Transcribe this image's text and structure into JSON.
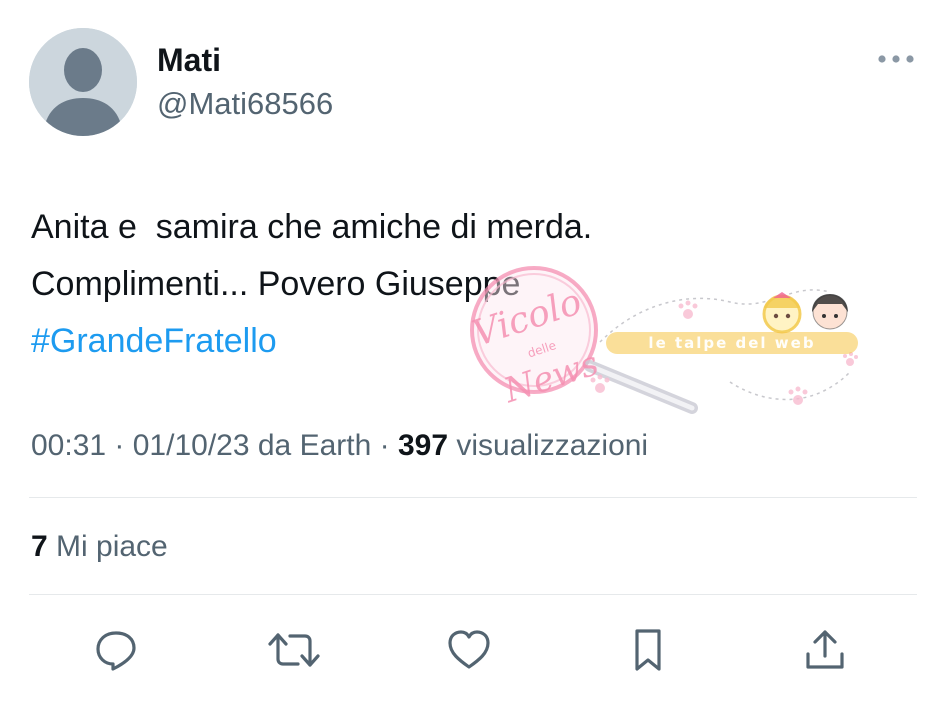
{
  "tweet": {
    "author": {
      "display_name": "Mati",
      "handle": "@Mati68566",
      "avatar": "default-avatar-placeholder"
    },
    "more_icon": "more-horizontal-icon",
    "text_lines": [
      "Anita e  samira che amiche di merda.",
      "Complimenti... Povero Giuseppe"
    ],
    "hashtag": "#GrandeFratello",
    "meta": {
      "time": "00:31",
      "separator1": " · ",
      "date": "01/10/23",
      "source": " da Earth",
      "separator2": " · ",
      "views_count": "397",
      "views_label": " visualizzazioni"
    },
    "likes": {
      "count": "7",
      "label": " Mi piace"
    },
    "actions": [
      {
        "name": "reply",
        "icon": "reply-icon"
      },
      {
        "name": "retweet",
        "icon": "retweet-icon"
      },
      {
        "name": "like",
        "icon": "heart-icon"
      },
      {
        "name": "bookmark",
        "icon": "bookmark-icon"
      },
      {
        "name": "share",
        "icon": "share-icon"
      }
    ]
  },
  "watermark": {
    "brand": "Vicolo delle News",
    "brand_line1": "Vicolo",
    "brand_line2": "delle",
    "brand_line3": "News",
    "tagline": "le talpe del web"
  },
  "colors": {
    "text_primary": "#0f1419",
    "text_secondary": "#536471",
    "link_blue": "#1d9bf0",
    "divider": "#e6e9eb",
    "avatar_bg": "#ccd6dd",
    "avatar_figure": "#6b7b8a",
    "watermark_pink": "#f48fb1",
    "watermark_gold": "#f2c94c"
  }
}
